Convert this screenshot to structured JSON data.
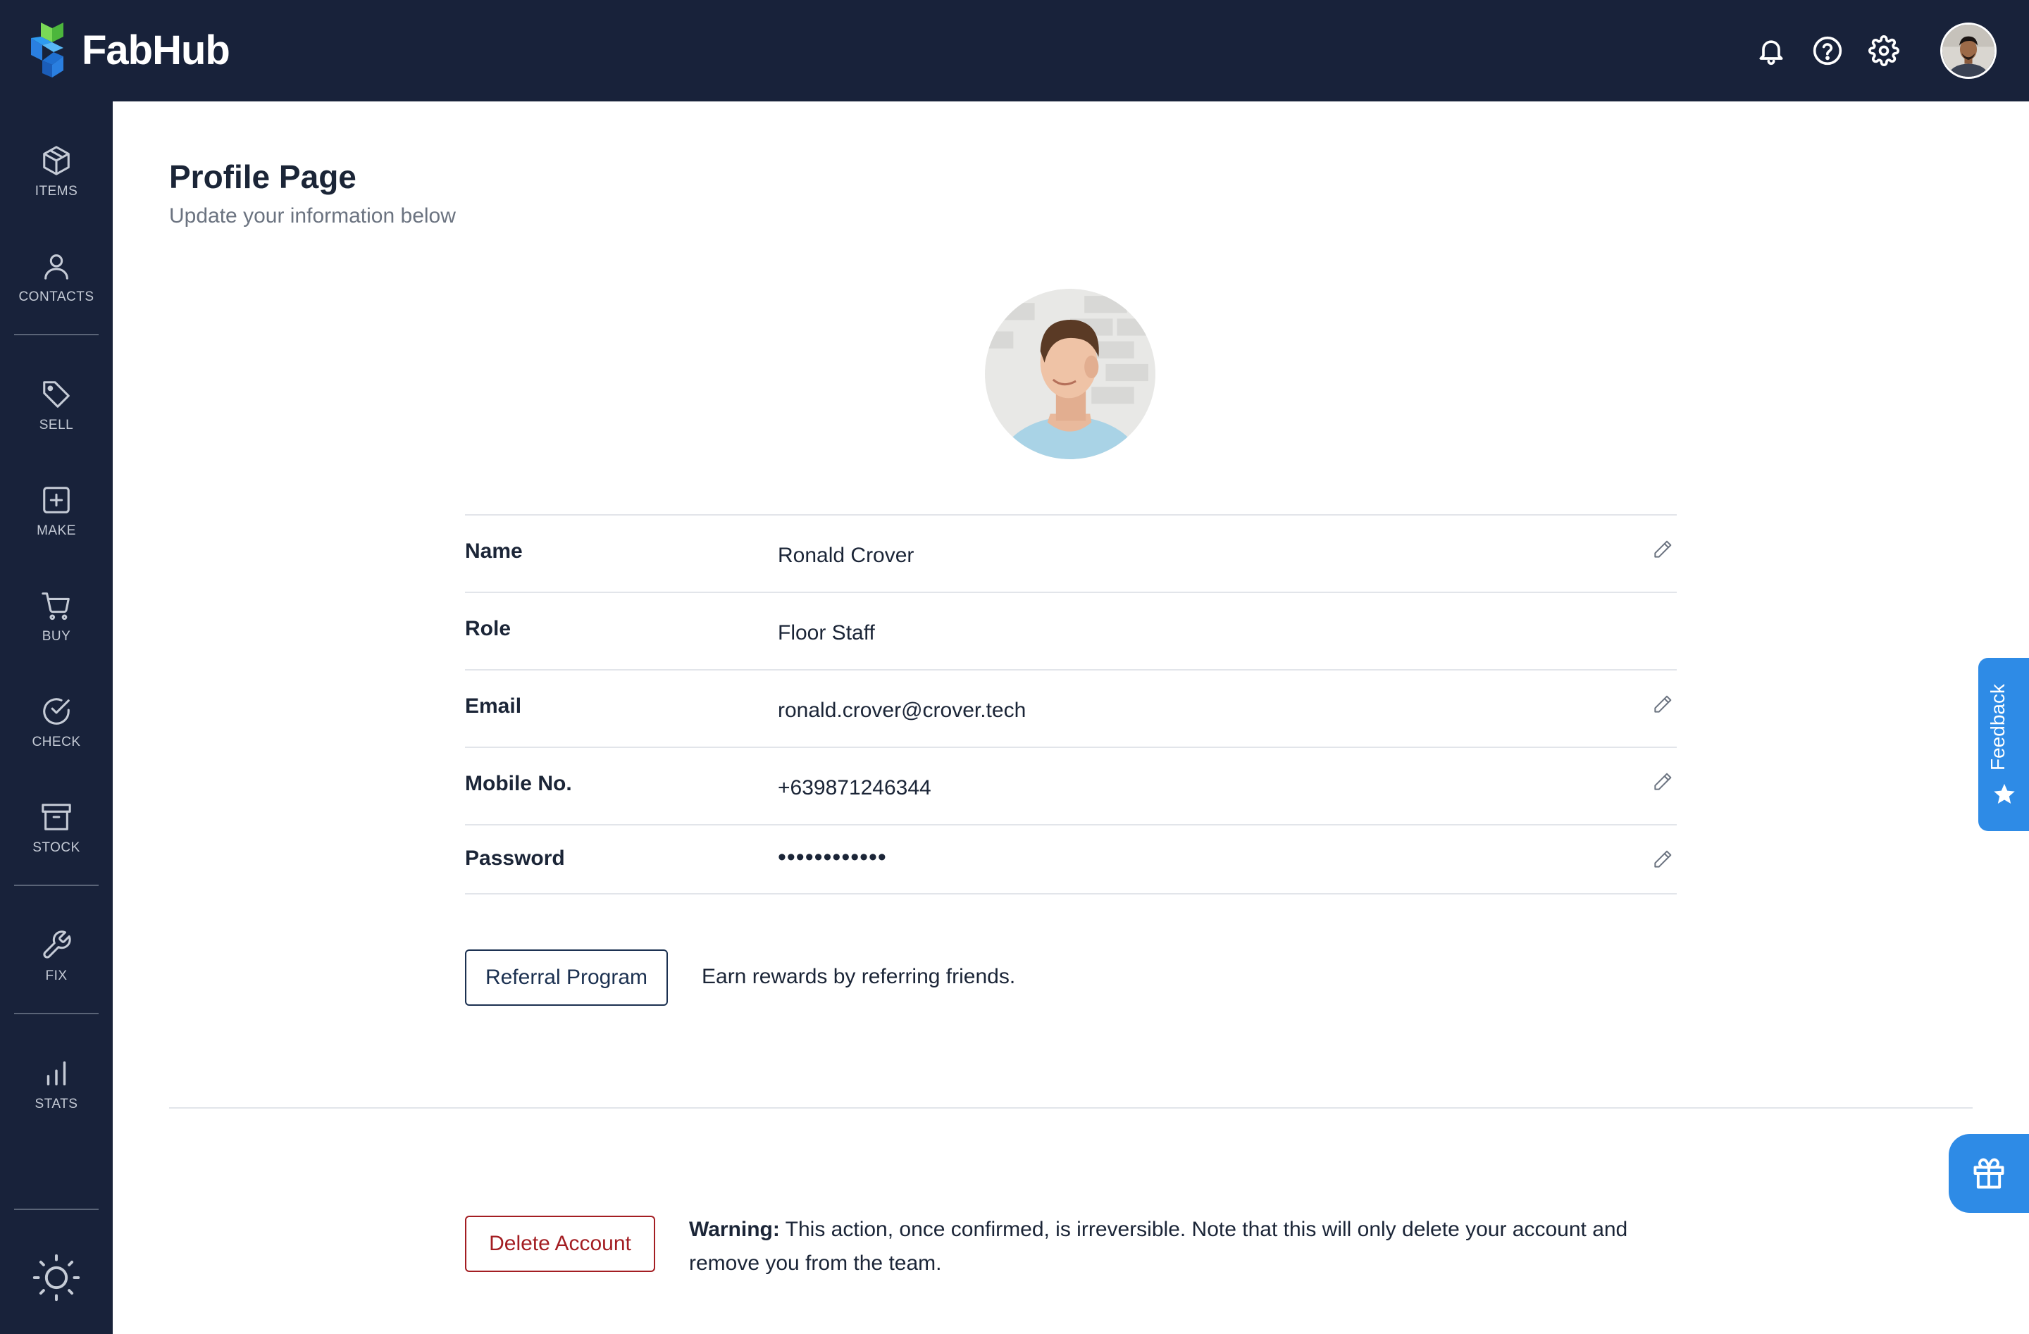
{
  "app": {
    "name": "FabHub"
  },
  "topbar": {
    "icons": [
      "bell-icon",
      "help-icon",
      "settings-icon"
    ],
    "avatar": "user-avatar"
  },
  "sidebar": {
    "items": [
      {
        "label": "ITEMS",
        "icon": "cube-icon"
      },
      {
        "label": "CONTACTS",
        "icon": "person-icon"
      },
      {
        "label": "SELL",
        "icon": "tag-icon"
      },
      {
        "label": "MAKE",
        "icon": "plus-square-icon"
      },
      {
        "label": "BUY",
        "icon": "cart-icon"
      },
      {
        "label": "CHECK",
        "icon": "check-circle-icon"
      },
      {
        "label": "STOCK",
        "icon": "archive-icon"
      },
      {
        "label": "FIX",
        "icon": "wrench-icon"
      },
      {
        "label": "STATS",
        "icon": "bar-chart-icon"
      }
    ],
    "theme_toggle": "sun-icon"
  },
  "page": {
    "title": "Profile Page",
    "subtitle": "Update your information below"
  },
  "profile": {
    "fields": [
      {
        "label": "Name",
        "value": "Ronald Crover",
        "editable": true
      },
      {
        "label": "Role",
        "value": "Floor Staff",
        "editable": false
      },
      {
        "label": "Email",
        "value": "ronald.crover@crover.tech",
        "editable": true
      },
      {
        "label": "Mobile No.",
        "value": "+639871246344",
        "editable": true
      },
      {
        "label": "Password",
        "value": "••••••••••••",
        "editable": true
      }
    ]
  },
  "referral": {
    "button_label": "Referral Program",
    "text": "Earn rewards by referring friends."
  },
  "danger": {
    "button_label": "Delete Account",
    "warning_title": "Warning:",
    "warning_text": " This action, once confirmed, is irreversible. Note that this will only delete your account and remove you from the team."
  },
  "widgets": {
    "feedback_label": "Feedback",
    "gift_icon": "gift-icon"
  },
  "colors": {
    "nav_bg": "#18223a",
    "accent_blue": "#2e8be6",
    "danger_red": "#a31d22",
    "logo_green": "#5cc64a",
    "logo_blue": "#2a7fe0"
  }
}
